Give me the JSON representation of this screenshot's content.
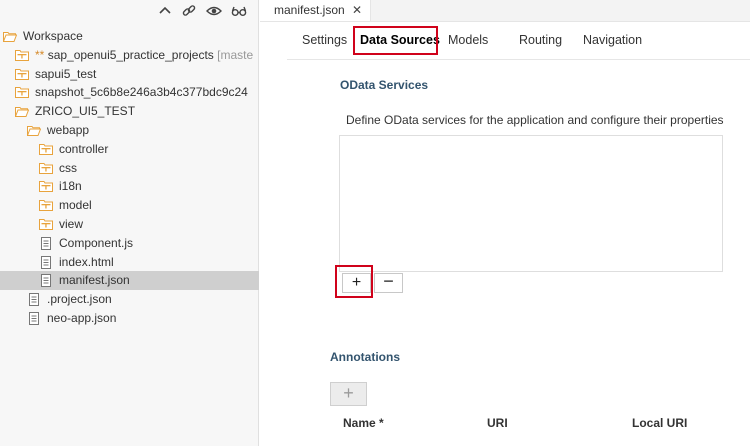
{
  "sidebar": {
    "tree": [
      {
        "label": "Workspace",
        "type": "folder-open"
      },
      {
        "prefix": "** ",
        "label": "sap_openui5_practice_projects",
        "suffix": " [maste",
        "type": "project"
      },
      {
        "label": "sapui5_test",
        "type": "project"
      },
      {
        "label": "snapshot_5c6b8e246a3b4c377bdc9c24",
        "type": "project"
      },
      {
        "label": "ZRICO_UI5_TEST",
        "type": "folder-open"
      },
      {
        "label": "webapp",
        "type": "folder-open"
      },
      {
        "label": "controller",
        "type": "folder"
      },
      {
        "label": "css",
        "type": "folder"
      },
      {
        "label": "i18n",
        "type": "folder"
      },
      {
        "label": "model",
        "type": "folder"
      },
      {
        "label": "view",
        "type": "folder"
      },
      {
        "label": "Component.js",
        "type": "file"
      },
      {
        "label": "index.html",
        "type": "file"
      },
      {
        "label": "manifest.json",
        "type": "file",
        "selected": true
      },
      {
        "label": ".project.json",
        "type": "file"
      },
      {
        "label": "neo-app.json",
        "type": "file"
      }
    ]
  },
  "editor": {
    "file_tab": {
      "label": "manifest.json",
      "close": "✕"
    },
    "tabs": [
      "Settings",
      "Data Sources",
      "Models",
      "Routing",
      "Navigation"
    ],
    "active_tab": "Data Sources",
    "odata": {
      "title": "OData Services",
      "description": "Define OData services for the application and configure their properties",
      "add": "+",
      "remove": "−"
    },
    "annotations": {
      "title": "Annotations",
      "add": "+",
      "columns": [
        "Name *",
        "URI",
        "Local URI"
      ]
    }
  },
  "colors": {
    "folder": "#e8a33d",
    "highlight": "#d0021b",
    "section_title": "#33546e",
    "selected_row": "#cfcfcf"
  }
}
